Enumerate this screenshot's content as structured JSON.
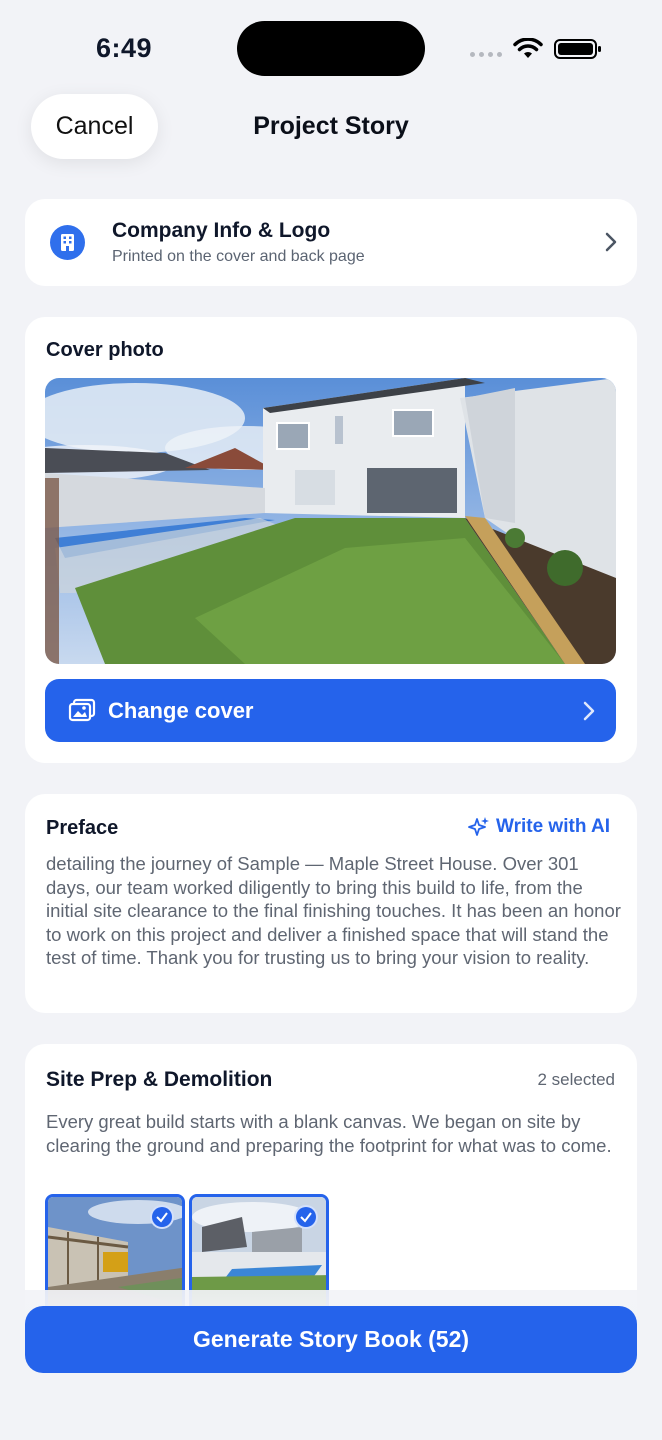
{
  "status_bar": {
    "time": "6:49"
  },
  "nav": {
    "cancel_label": "Cancel",
    "title": "Project Story"
  },
  "company": {
    "title": "Company Info & Logo",
    "subtitle": "Printed on the cover and back page",
    "icon": "building-icon"
  },
  "cover": {
    "heading": "Cover photo",
    "change_label": "Change cover",
    "icon": "photos-icon"
  },
  "preface": {
    "heading": "Preface",
    "ai_label": "Write with AI",
    "text": "detailing the journey of Sample — Maple Street House. Over 301 days, our team worked diligently to bring this build to life, from the initial site clearance to the final finishing touches. It has been an honor to work on this project and deliver a finished space that will stand the test of time. Thank you for trusting us to bring your vision to reality."
  },
  "sections": [
    {
      "title": "Site Prep & Demolition",
      "selected": "2 selected",
      "text": "Every great build starts with a blank canvas. We began on site by clearing the ground and preparing the footprint for what was to come."
    }
  ],
  "footer": {
    "generate_label": "Generate Story Book (52)"
  },
  "colors": {
    "accent": "#2563eb",
    "background": "#f2f3f7",
    "card": "#ffffff"
  }
}
